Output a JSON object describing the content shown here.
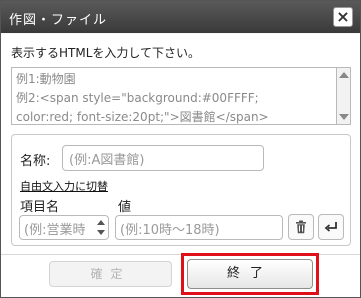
{
  "window": {
    "title": "作図・ファイル",
    "close_glyph": "×"
  },
  "main": {
    "prompt": "表示するHTMLを入力して下さい。",
    "html_placeholder_lines": [
      "例1:動物園",
      "例2:<span style=\"background:#00FFFF;",
      "color:red; font-size:20pt;\">図書館</span>"
    ]
  },
  "panel": {
    "name_label": "名称:",
    "name_placeholder": "(例:A図書館)",
    "free_input_link": "自由文入力に切替",
    "item_header": "項目名",
    "value_header": "値",
    "item_placeholder": "(例:営業時",
    "value_placeholder": "(例:10時〜18時)"
  },
  "footer": {
    "confirm_label": "確定",
    "finish_label": "終了"
  },
  "icons": {
    "trash": "trash-icon",
    "enter": "enter-icon"
  },
  "colors": {
    "titlebar": "#444444",
    "highlight": "#e0101a"
  }
}
